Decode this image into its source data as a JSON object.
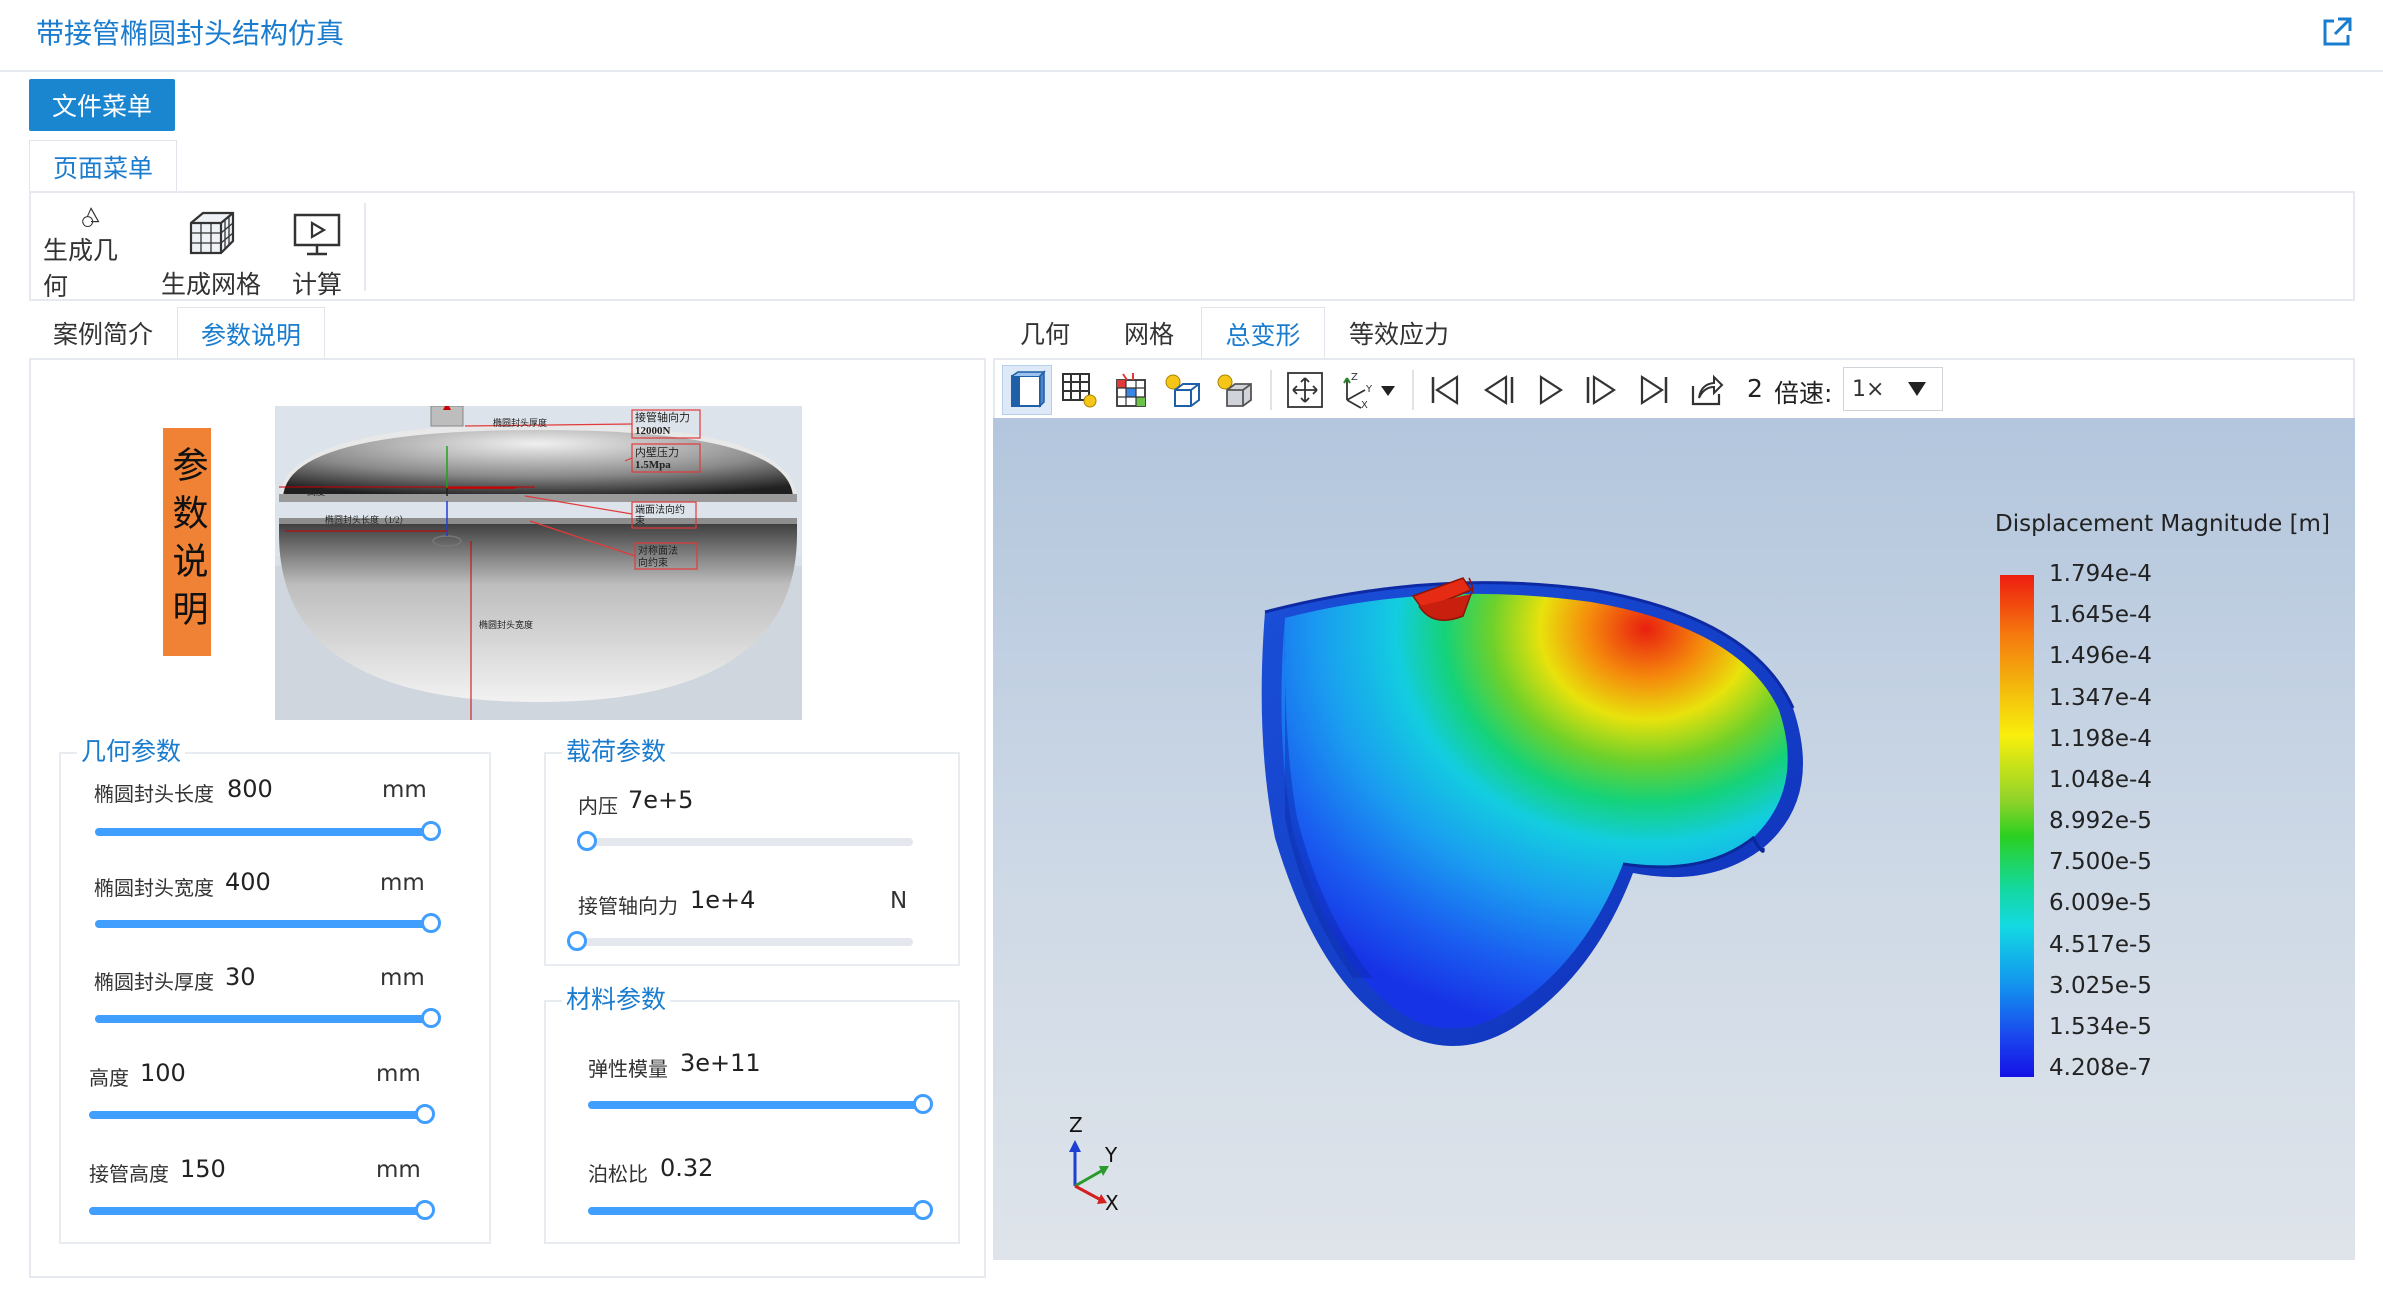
{
  "app": {
    "title": "带接管椭圆封头结构仿真"
  },
  "file_menu": {
    "label": "文件菜单"
  },
  "page_menu_tab": {
    "label": "页面菜单"
  },
  "ribbon": {
    "items": [
      {
        "label": "生成几何",
        "icon": "geometry-shapes-icon"
      },
      {
        "label": "生成网格",
        "icon": "mesh-cube-icon"
      },
      {
        "label": "计算",
        "icon": "compute-monitor-icon"
      }
    ]
  },
  "left_tabs": [
    {
      "label": "案例简介",
      "active": false
    },
    {
      "label": "参数说明",
      "active": true
    }
  ],
  "param_banner": "参数说明",
  "diagram": {
    "labels": {
      "axial_force": "接管轴向力",
      "axial_force_value": "12000N",
      "inner_pressure": "内壁压力",
      "inner_pressure_value": "1.5Mpa",
      "end_constraint_1": "端面法向约",
      "end_constraint_2": "束",
      "sym_constraint_1": "对称面法",
      "sym_constraint_2": "向约束",
      "thickness": "椭圆封头厚度",
      "height": "高度",
      "length_half": "椭圆封头长度（1/2）",
      "width": "椭圆封头宽度"
    }
  },
  "geometry_group": {
    "title": "几何参数",
    "params": [
      {
        "label": "椭圆封头长度",
        "value": "800",
        "unit": "mm",
        "fraction": 1.0
      },
      {
        "label": "椭圆封头宽度",
        "value": "400",
        "unit": "mm",
        "fraction": 1.0
      },
      {
        "label": "椭圆封头厚度",
        "value": "30",
        "unit": "mm",
        "fraction": 1.0
      },
      {
        "label": "高度",
        "value": "100",
        "unit": "mm",
        "fraction": 1.0
      },
      {
        "label": "接管高度",
        "value": "150",
        "unit": "mm",
        "fraction": 1.0
      }
    ]
  },
  "load_group": {
    "title": "载荷参数",
    "params": [
      {
        "label": "内压",
        "value": "7e+5",
        "unit": "",
        "fraction": 0.0
      },
      {
        "label": "接管轴向力",
        "value": "1e+4",
        "unit": "N",
        "fraction": 0.0
      }
    ]
  },
  "material_group": {
    "title": "材料参数",
    "params": [
      {
        "label": "弹性模量",
        "value": "3e+11",
        "unit": "",
        "fraction": 1.0
      },
      {
        "label": "泊松比",
        "value": "0.32",
        "unit": "",
        "fraction": 1.0
      }
    ]
  },
  "right_tabs": [
    {
      "label": "几何",
      "active": false
    },
    {
      "label": "网格",
      "active": false
    },
    {
      "label": "总变形",
      "active": true
    },
    {
      "label": "等效应力",
      "active": false
    }
  ],
  "viewer_toolbar": {
    "frame": "2",
    "speed_label": "倍速:",
    "speed_value": "1×"
  },
  "legend": {
    "title": "Displacement Magnitude [m]",
    "values": [
      "1.794e-4",
      "1.645e-4",
      "1.496e-4",
      "1.347e-4",
      "1.198e-4",
      "1.048e-4",
      "8.992e-5",
      "7.500e-5",
      "6.009e-5",
      "4.517e-5",
      "3.025e-5",
      "1.534e-5",
      "4.208e-7"
    ]
  },
  "axes": {
    "x": "X",
    "y": "Y",
    "z": "Z"
  },
  "colors": {
    "accent": "#1a7ccf",
    "button": "#1a86d0",
    "banner": "#f08236",
    "slider": "#409eff"
  }
}
